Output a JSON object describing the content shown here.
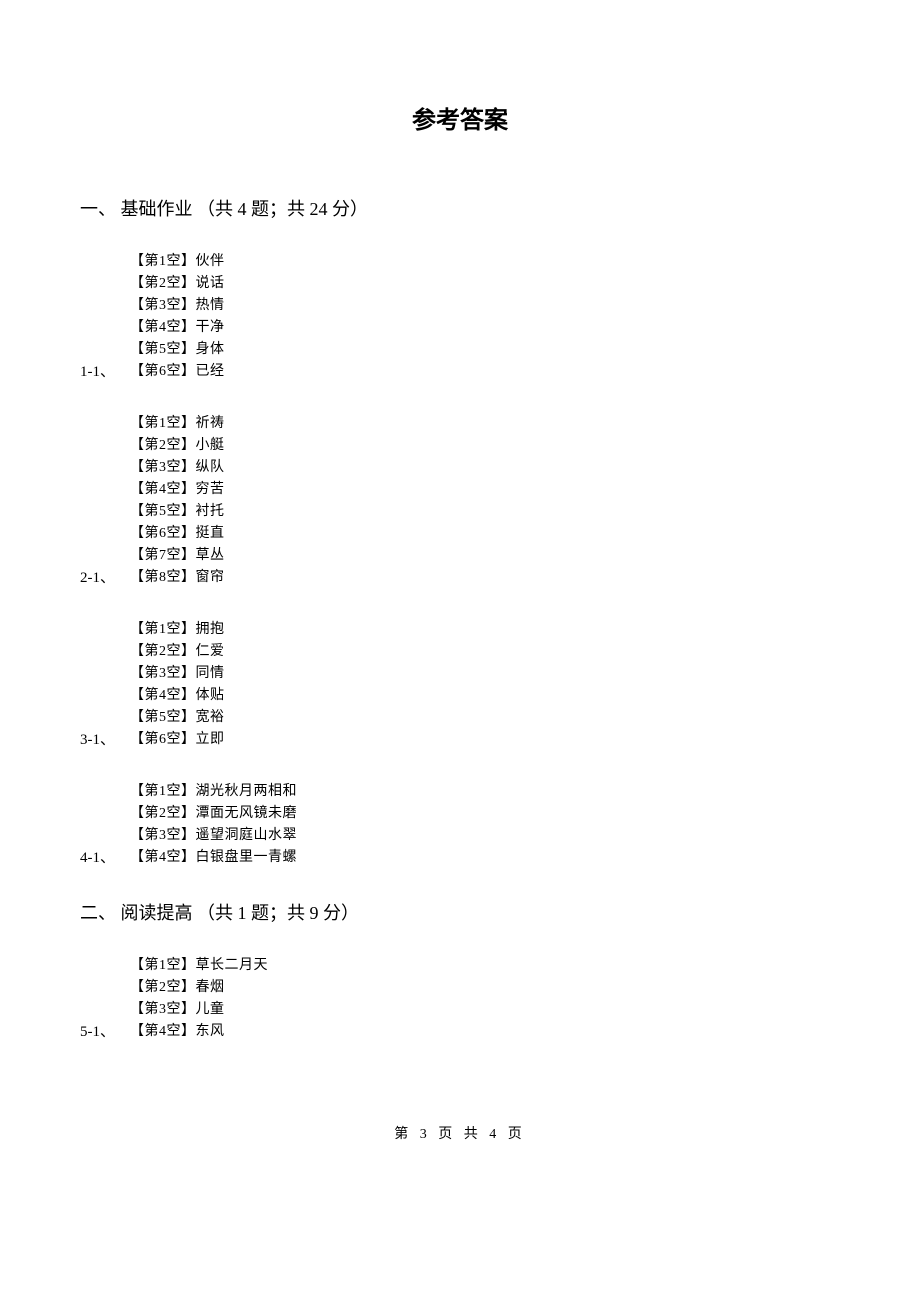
{
  "page_title": "参考答案",
  "sections": [
    {
      "heading": "一、 基础作业 （共 4 题；共 24 分）",
      "blocks": [
        {
          "label": "1-1、",
          "answers": [
            "伙伴",
            "说话",
            "热情",
            "干净",
            "身体",
            "已经"
          ]
        },
        {
          "label": "2-1、",
          "answers": [
            "祈祷",
            "小艇",
            "纵队",
            "穷苦",
            "衬托",
            "挺直",
            "草丛",
            "窗帘"
          ]
        },
        {
          "label": "3-1、",
          "answers": [
            "拥抱",
            "仁爱",
            "同情",
            "体贴",
            "宽裕",
            "立即"
          ]
        },
        {
          "label": "4-1、",
          "answers": [
            "湖光秋月两相和",
            "潭面无风镜未磨",
            "遥望洞庭山水翠",
            "白银盘里一青螺"
          ]
        }
      ]
    },
    {
      "heading": "二、 阅读提高 （共 1 题；共 9 分）",
      "blocks": [
        {
          "label": "5-1、",
          "answers": [
            "草长二月天",
            "春烟",
            "儿童",
            "东风"
          ]
        }
      ]
    }
  ],
  "footer": "第 3 页 共 4 页",
  "blank_prefix": "【第",
  "blank_suffix": "空】"
}
